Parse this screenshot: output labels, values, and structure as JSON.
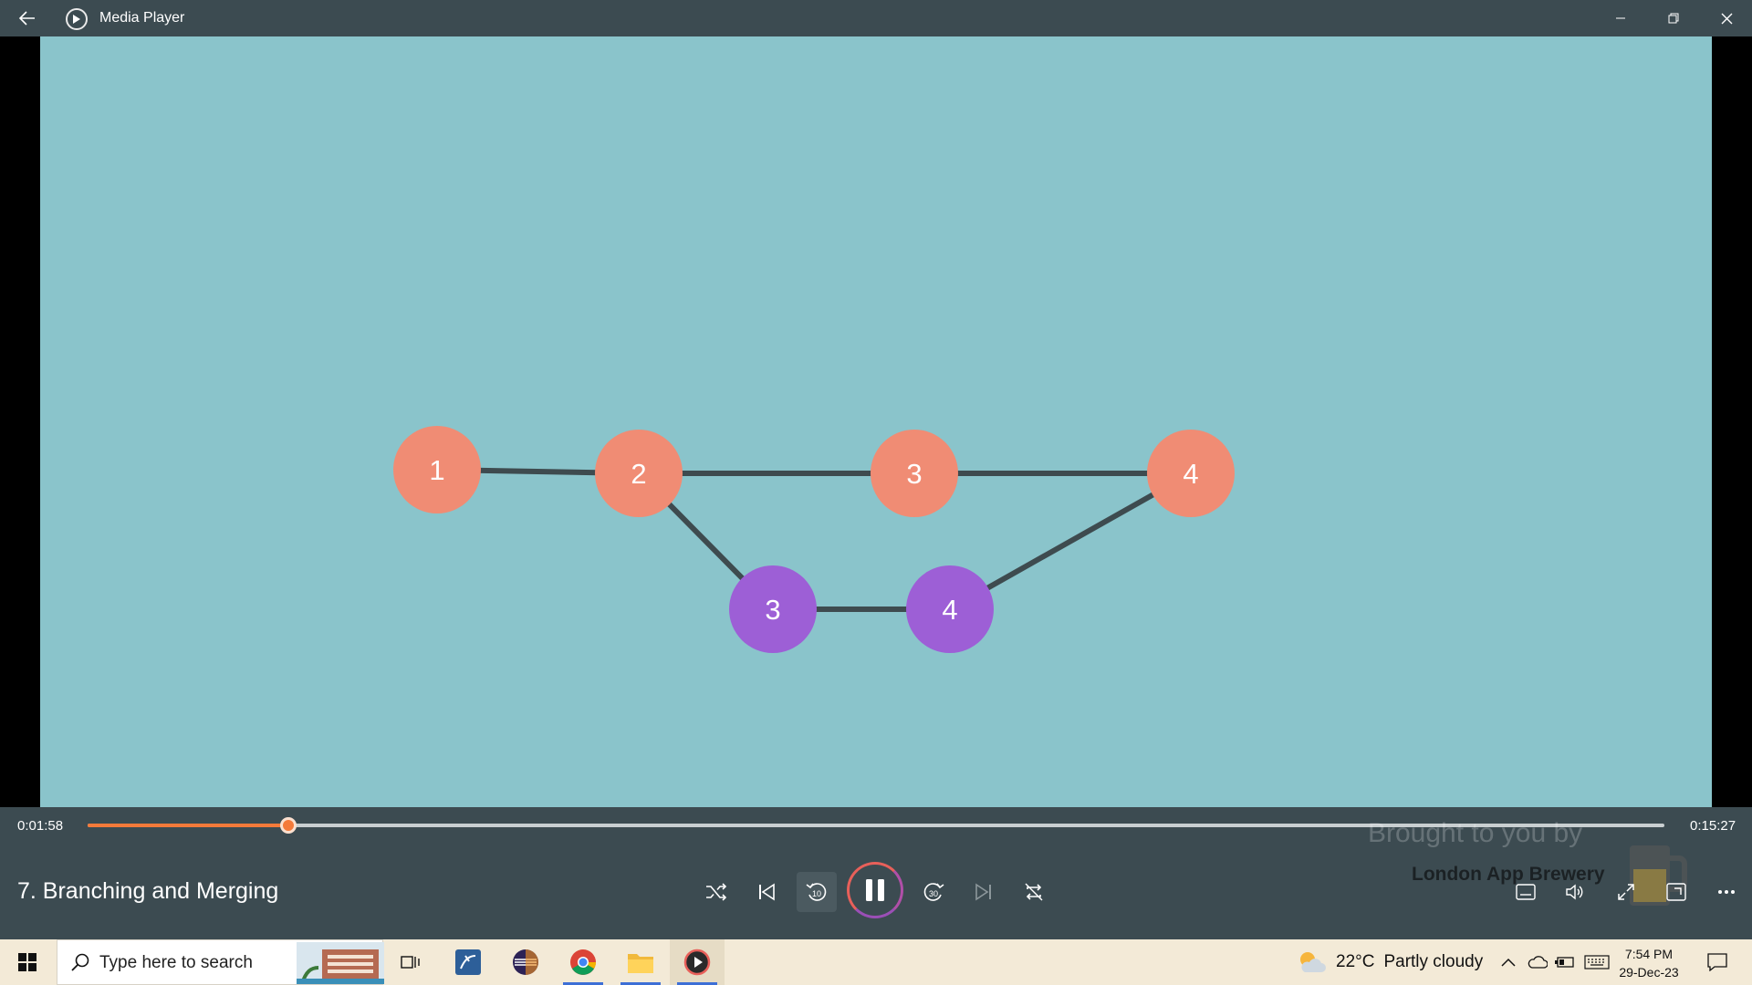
{
  "window": {
    "app_title": "Media Player",
    "colors": {
      "chrome": "#3c4b51",
      "accent": "#f47a3a",
      "video_bg": "#8ac4cb"
    }
  },
  "video": {
    "diagram": {
      "main_nodes": [
        "1",
        "2",
        "3",
        "4"
      ],
      "branch_nodes": [
        "3",
        "4"
      ],
      "colors": {
        "main": "#f08c74",
        "branch": "#9d5fd6",
        "edge": "#3e4b4f"
      }
    }
  },
  "player": {
    "elapsed": "0:01:58",
    "total": "0:15:27",
    "progress_fraction": 0.1273,
    "media_title": "7. Branching and Merging",
    "watermark_line1": "Brought to you by",
    "watermark_line2": "London App Brewery",
    "icons": {
      "shuffle": "shuffle-icon",
      "previous": "previous-icon",
      "skip_back": "skip-back-10-icon",
      "play_pause": "pause-icon",
      "skip_forward": "skip-forward-30-icon",
      "next": "next-icon",
      "repeat": "repeat-icon",
      "captions": "captions-icon",
      "volume": "volume-icon",
      "fullscreen": "fullscreen-icon",
      "mini_player": "mini-player-icon",
      "more": "more-icon"
    },
    "skip_back_seconds": "10",
    "skip_forward_seconds": "30"
  },
  "taskbar": {
    "search_placeholder": "Type here to search",
    "weather_temp": "22°C",
    "weather_text": "Partly cloudy",
    "time": "7:54 PM",
    "date": "29-Dec-23"
  }
}
